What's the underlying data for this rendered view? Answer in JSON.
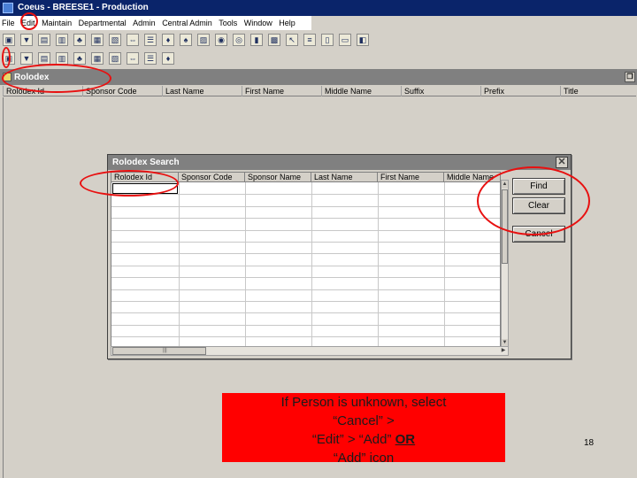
{
  "window": {
    "title": "Coeus - BREESE1 - Production"
  },
  "menu": {
    "items": [
      "File",
      "Edit",
      "Maintain",
      "Departmental",
      "Admin",
      "Central Admin",
      "Tools",
      "Window",
      "Help"
    ]
  },
  "toolbar": {
    "row1_icons": [
      "open-icon",
      "arrow-down-icon",
      "proposal-icon",
      "budget-icon",
      "award-icon",
      "person-icon",
      "medusa-icon",
      "negotiation-icon",
      "subcontract-icon",
      "organization-icon",
      "sponsor-icon",
      "rolodex-card-icon",
      "user-icon",
      "globe-icon",
      "unit-icon",
      "printer-icon",
      "cursor-icon",
      "list-icon",
      "columns-icon",
      "window-icon",
      "exit-icon"
    ],
    "row2_icons": [
      "new-icon",
      "rolodex-icon",
      "calculator-icon",
      "edit-pencil-icon",
      "copy-icon",
      "grid-icon",
      "table-icon",
      "query-icon",
      "save-icon",
      "notes-icon"
    ]
  },
  "rolodex_frame": {
    "title": "Rolodex",
    "columns": [
      "Rolodex Id",
      "Sponsor Code",
      "Last Name",
      "First Name",
      "Middle Name",
      "Suffix",
      "Prefix",
      "Title"
    ]
  },
  "search_dialog": {
    "title": "Rolodex Search",
    "columns": [
      "Rolodex Id",
      "Sponsor Code",
      "Sponsor Name",
      "Last Name",
      "First Name",
      "Middle Name"
    ],
    "buttons": {
      "find": "Find",
      "clear": "Clear",
      "cancel": "Cancel"
    }
  },
  "annotation": {
    "line1": "If Person is unknown, select",
    "line2": "“Cancel” >",
    "line3_prefix": "“Edit” > “Add” ",
    "line3_or": "OR",
    "line4": "“Add” icon",
    "color": "#ff0000",
    "ring_color": "#e81010"
  },
  "slide_number": "18"
}
